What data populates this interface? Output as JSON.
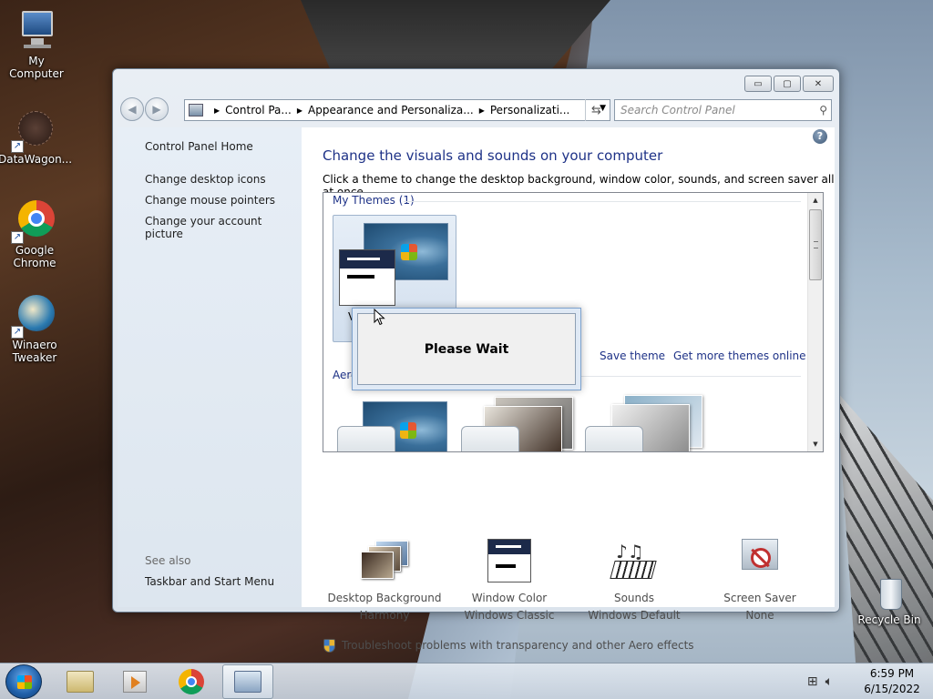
{
  "desktop": {
    "icons": [
      {
        "label": "My Computer"
      },
      {
        "label": "DataWagon..."
      },
      {
        "label": "Google Chrome"
      },
      {
        "label": "Winaero Tweaker"
      },
      {
        "label": "Recycle Bin"
      }
    ]
  },
  "window": {
    "controls": {
      "minimize": "▭",
      "maximize": "▢",
      "close": "✕"
    },
    "breadcrumb": [
      "Control Pa...",
      "Appearance and Personaliza...",
      "Personalizati..."
    ],
    "search": {
      "placeholder": "Search Control Panel"
    },
    "left_pane": {
      "home": "Control Panel Home",
      "links": [
        "Change desktop icons",
        "Change mouse pointers",
        "Change your account picture"
      ],
      "see_also_label": "See also",
      "see_also_links": [
        "Taskbar and Start Menu"
      ]
    },
    "content": {
      "heading": "Change the visuals and sounds on your computer",
      "subheading": "Click a theme to change the desktop background, window color, sounds, and screen saver all at once.",
      "my_themes_label": "My Themes (1)",
      "my_theme_name_partial": "V",
      "aero_label_partial": "Aero",
      "save_theme": "Save theme",
      "get_more_themes": "Get more themes online",
      "dialog_text": "Please Wait",
      "bottom": [
        {
          "title": "Desktop Background",
          "value": "Harmony",
          "icon": "desktop-background-icon"
        },
        {
          "title": "Window Color",
          "value": "Windows Classic",
          "icon": "window-color-icon"
        },
        {
          "title": "Sounds",
          "value": "Windows Default",
          "icon": "sounds-icon"
        },
        {
          "title": "Screen Saver",
          "value": "None",
          "icon": "screen-saver-icon"
        }
      ],
      "troubleshoot": "Troubleshoot problems with transparency and other Aero effects"
    }
  },
  "taskbar": {
    "time": "6:59 PM",
    "date": "6/15/2022"
  }
}
